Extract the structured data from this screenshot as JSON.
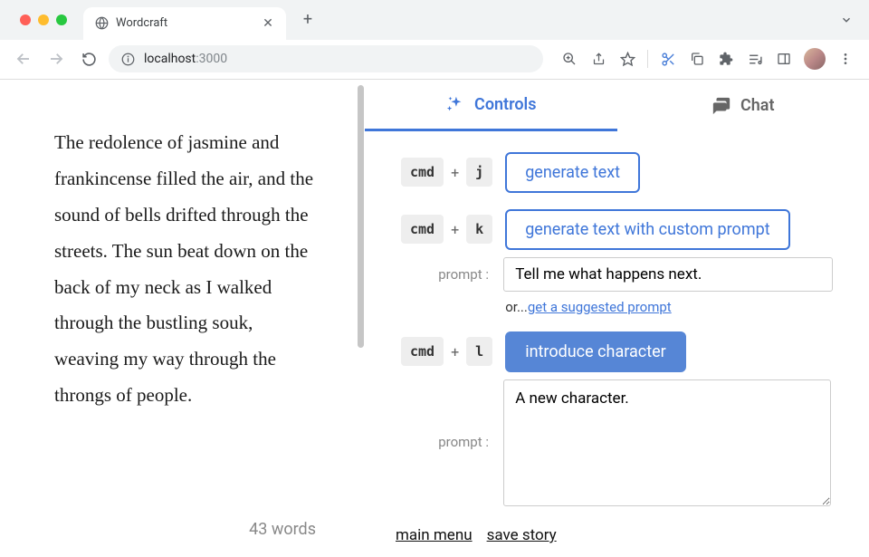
{
  "browser": {
    "tab_title": "Wordcraft",
    "url_host": "localhost",
    "url_port": ":3000"
  },
  "story": {
    "text": " The redolence of jasmine and frankincense filled the air, and the sound of bells drifted through the streets. The sun beat down on the back of my neck as I walked through the bustling souk, weaving my way through the throngs of people.",
    "word_count": "43 words"
  },
  "tabs": {
    "controls": "Controls",
    "chat": "Chat"
  },
  "controls": {
    "cmd": "cmd",
    "plus": "+",
    "key_j": "j",
    "key_k": "k",
    "key_l": "l",
    "generate_text": "generate text",
    "generate_custom": "generate text with custom prompt",
    "introduce_character": "introduce character",
    "prompt_label": "prompt :",
    "prompt_value_k": "Tell me what happens next.",
    "prompt_value_l": "A new character.",
    "or_prefix": "or...",
    "suggest_link": "get a suggested prompt"
  },
  "footer": {
    "main_menu": "main menu",
    "save_story": "save story"
  }
}
